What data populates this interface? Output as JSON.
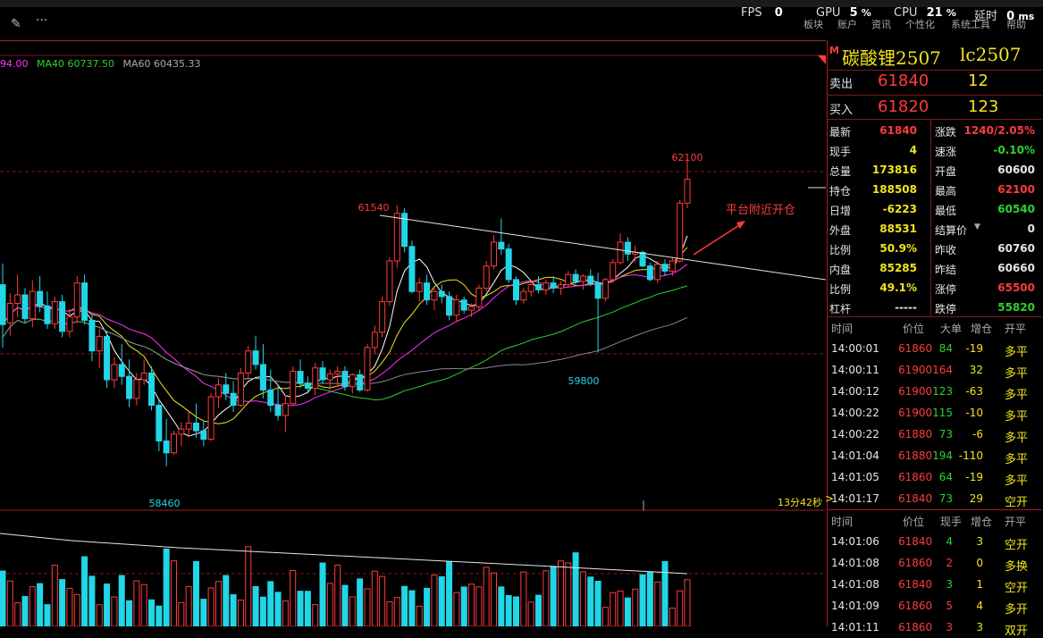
{
  "toolbar": {
    "pen_icon": "pencil-icon",
    "more_icon": "ellipsis-icon",
    "fps_label": "FPS",
    "fps_value": "0",
    "gpu_label": "GPU",
    "gpu_value": "5",
    "cpu_label": "CPU",
    "cpu_value": "21",
    "delay_label": "延时",
    "delay_value": "0",
    "pct": "%",
    "ms": "ms",
    "menu": [
      "板块",
      "账户",
      "资讯",
      "个性化",
      "系统工具",
      "帮助"
    ]
  },
  "chart": {
    "ma_legend": [
      {
        "text": "94.00",
        "color": "#ff33ff"
      },
      {
        "text": "MA40 60737.50",
        "color": "#2fd12f"
      },
      {
        "text": "MA60 60435.33",
        "color": "#aaaaaa"
      }
    ],
    "labels": {
      "high": "62100",
      "peak": "61540",
      "low_mid": "59800",
      "low": "58460",
      "annotation": "平台附近开仓",
      "countdown": "13分42秒"
    },
    "colors": {
      "up": "#ff3b3b",
      "down": "#21d6e6",
      "ma_white": "#ffffff",
      "ma_yellow": "#f2e41d",
      "ma_magenta": "#ff33ff",
      "ma_green": "#2fd12f",
      "ma_gray": "#888888"
    }
  },
  "quote": {
    "corner_mark": "M",
    "title": "碳酸锂2507",
    "code": "lc2507",
    "ask": {
      "label": "卖出",
      "price": "61840",
      "volume": "12"
    },
    "bid": {
      "label": "买入",
      "price": "61820",
      "volume": "123"
    },
    "stats": [
      {
        "l1": "最新",
        "v1": "61840",
        "c1": "red",
        "l2": "涨跌",
        "v2": "1240/2.05%",
        "c2": "red"
      },
      {
        "l1": "现手",
        "v1": "4",
        "c1": "yellow",
        "l2": "速涨",
        "v2": "-0.10%",
        "c2": "green"
      },
      {
        "l1": "总量",
        "v1": "173816",
        "c1": "yellow",
        "l2": "开盘",
        "v2": "60600",
        "c2": "white"
      },
      {
        "l1": "持仓",
        "v1": "188508",
        "c1": "yellow",
        "l2": "最高",
        "v2": "62100",
        "c2": "red"
      },
      {
        "l1": "日增",
        "v1": "-6223",
        "c1": "yellow",
        "l2": "最低",
        "v2": "60540",
        "c2": "green"
      },
      {
        "l1": "外盘",
        "v1": "88531",
        "c1": "yellow",
        "l2": "结算价",
        "v2": "0",
        "c2": "white"
      },
      {
        "l1": "比例",
        "v1": "50.9%",
        "c1": "yellow",
        "l2": "昨收",
        "v2": "60760",
        "c2": "white"
      },
      {
        "l1": "内盘",
        "v1": "85285",
        "c1": "yellow",
        "l2": "昨结",
        "v2": "60660",
        "c2": "white"
      },
      {
        "l1": "比例",
        "v1": "49.1%",
        "c1": "yellow",
        "l2": "涨停",
        "v2": "65500",
        "c2": "red"
      },
      {
        "l1": "杠杆",
        "v1": "-----",
        "c1": "white",
        "l2": "跌停",
        "v2": "55820",
        "c2": "green"
      }
    ],
    "trades_a_header": [
      "时间",
      "价位",
      "大单",
      "增仓",
      "开平"
    ],
    "trades_a": [
      {
        "t": "14:00:01",
        "p": "61860",
        "v": "84",
        "d": "-19",
        "k": "多平",
        "dc": "yellow",
        "mark": ""
      },
      {
        "t": "14:00:11",
        "p": "61900",
        "v": "164",
        "d": "32",
        "k": "多平",
        "dc": "yellow",
        "vc": "red",
        "mark": ""
      },
      {
        "t": "14:00:12",
        "p": "61900",
        "v": "123",
        "d": "-63",
        "k": "多平",
        "dc": "yellow",
        "mark": ""
      },
      {
        "t": "14:00:22",
        "p": "61900",
        "v": "115",
        "d": "-10",
        "k": "多平",
        "dc": "yellow",
        "mark": ""
      },
      {
        "t": "14:00:22",
        "p": "61880",
        "v": "73",
        "d": "-6",
        "k": "多平",
        "dc": "yellow",
        "mark": ""
      },
      {
        "t": "14:01:04",
        "p": "61880",
        "v": "194",
        "d": "-110",
        "k": "多平",
        "dc": "yellow",
        "mark": ""
      },
      {
        "t": "14:01:05",
        "p": "61860",
        "v": "64",
        "d": "-19",
        "k": "多平",
        "dc": "yellow",
        "mark": ""
      },
      {
        "t": "14:01:17",
        "p": "61840",
        "v": "73",
        "d": "29",
        "k": "空开",
        "dc": "yellow",
        "mark": ">"
      }
    ],
    "trades_b_header": [
      "时间",
      "价位",
      "现手",
      "增仓",
      "开平"
    ],
    "trades_b": [
      {
        "t": "14:01:06",
        "p": "61840",
        "v": "4",
        "vc": "green",
        "d": "3",
        "k": "空开"
      },
      {
        "t": "14:01:08",
        "p": "61860",
        "v": "2",
        "vc": "red",
        "d": "0",
        "k": "多换"
      },
      {
        "t": "14:01:08",
        "p": "61840",
        "v": "3",
        "vc": "green",
        "d": "1",
        "k": "空开"
      },
      {
        "t": "14:01:09",
        "p": "61860",
        "v": "5",
        "vc": "red",
        "d": "4",
        "k": "多开"
      },
      {
        "t": "14:01:11",
        "p": "61860",
        "v": "3",
        "vc": "red",
        "d": "3",
        "k": "双开"
      }
    ]
  }
}
